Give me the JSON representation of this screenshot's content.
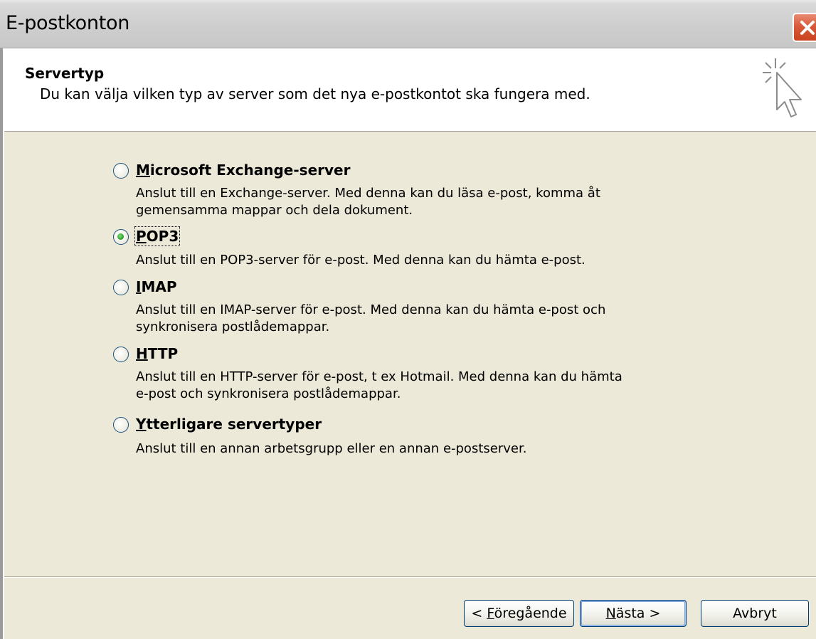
{
  "window": {
    "title": "E-postkonton"
  },
  "header": {
    "heading": "Servertyp",
    "description": "Du kan välja vilken typ av server som det nya e-postkontot ska fungera med."
  },
  "options": [
    {
      "mnemonic": "M",
      "label_rest": "icrosoft Exchange-server",
      "description_lines": [
        "Anslut till en Exchange-server. Med denna kan du läsa e-post, komma åt",
        "gemensamma mappar och dela dokument."
      ],
      "checked": false
    },
    {
      "mnemonic": "P",
      "label_rest": "OP3",
      "description_lines": [
        "Anslut till en POP3-server för e-post. Med denna kan du hämta e-post."
      ],
      "checked": true
    },
    {
      "mnemonic": "I",
      "label_rest": "MAP",
      "description_lines": [
        "Anslut till en IMAP-server för e-post. Med denna kan du hämta e-post och",
        "synkronisera postlådemappar."
      ],
      "checked": false
    },
    {
      "mnemonic": "H",
      "label_rest": "TTP",
      "description_lines": [
        "Anslut till en HTTP-server för e-post, t ex Hotmail. Med denna kan du hämta",
        "e-post och synkronisera postlådemappar."
      ],
      "checked": false
    },
    {
      "mnemonic": "Y",
      "label_rest": "tterligare servertyper",
      "description_lines": [
        "Anslut till en annan arbetsgrupp eller en annan e-postserver."
      ],
      "checked": false
    }
  ],
  "buttons": {
    "back": {
      "prefix": "< ",
      "mnemonic": "F",
      "rest": "öregående"
    },
    "next": {
      "mnemonic": "N",
      "rest": "ästa >"
    },
    "cancel": {
      "label": "Avbryt"
    }
  },
  "icons": {
    "close": "close-icon",
    "wizard": "wizard-cursor-icon"
  },
  "colors": {
    "titlebar": "#cfcfcf",
    "close_button": "#d9593a",
    "dialog_bg": "#ece9d8",
    "radio_checked": "#32a52f",
    "button_border": "#003c74"
  }
}
